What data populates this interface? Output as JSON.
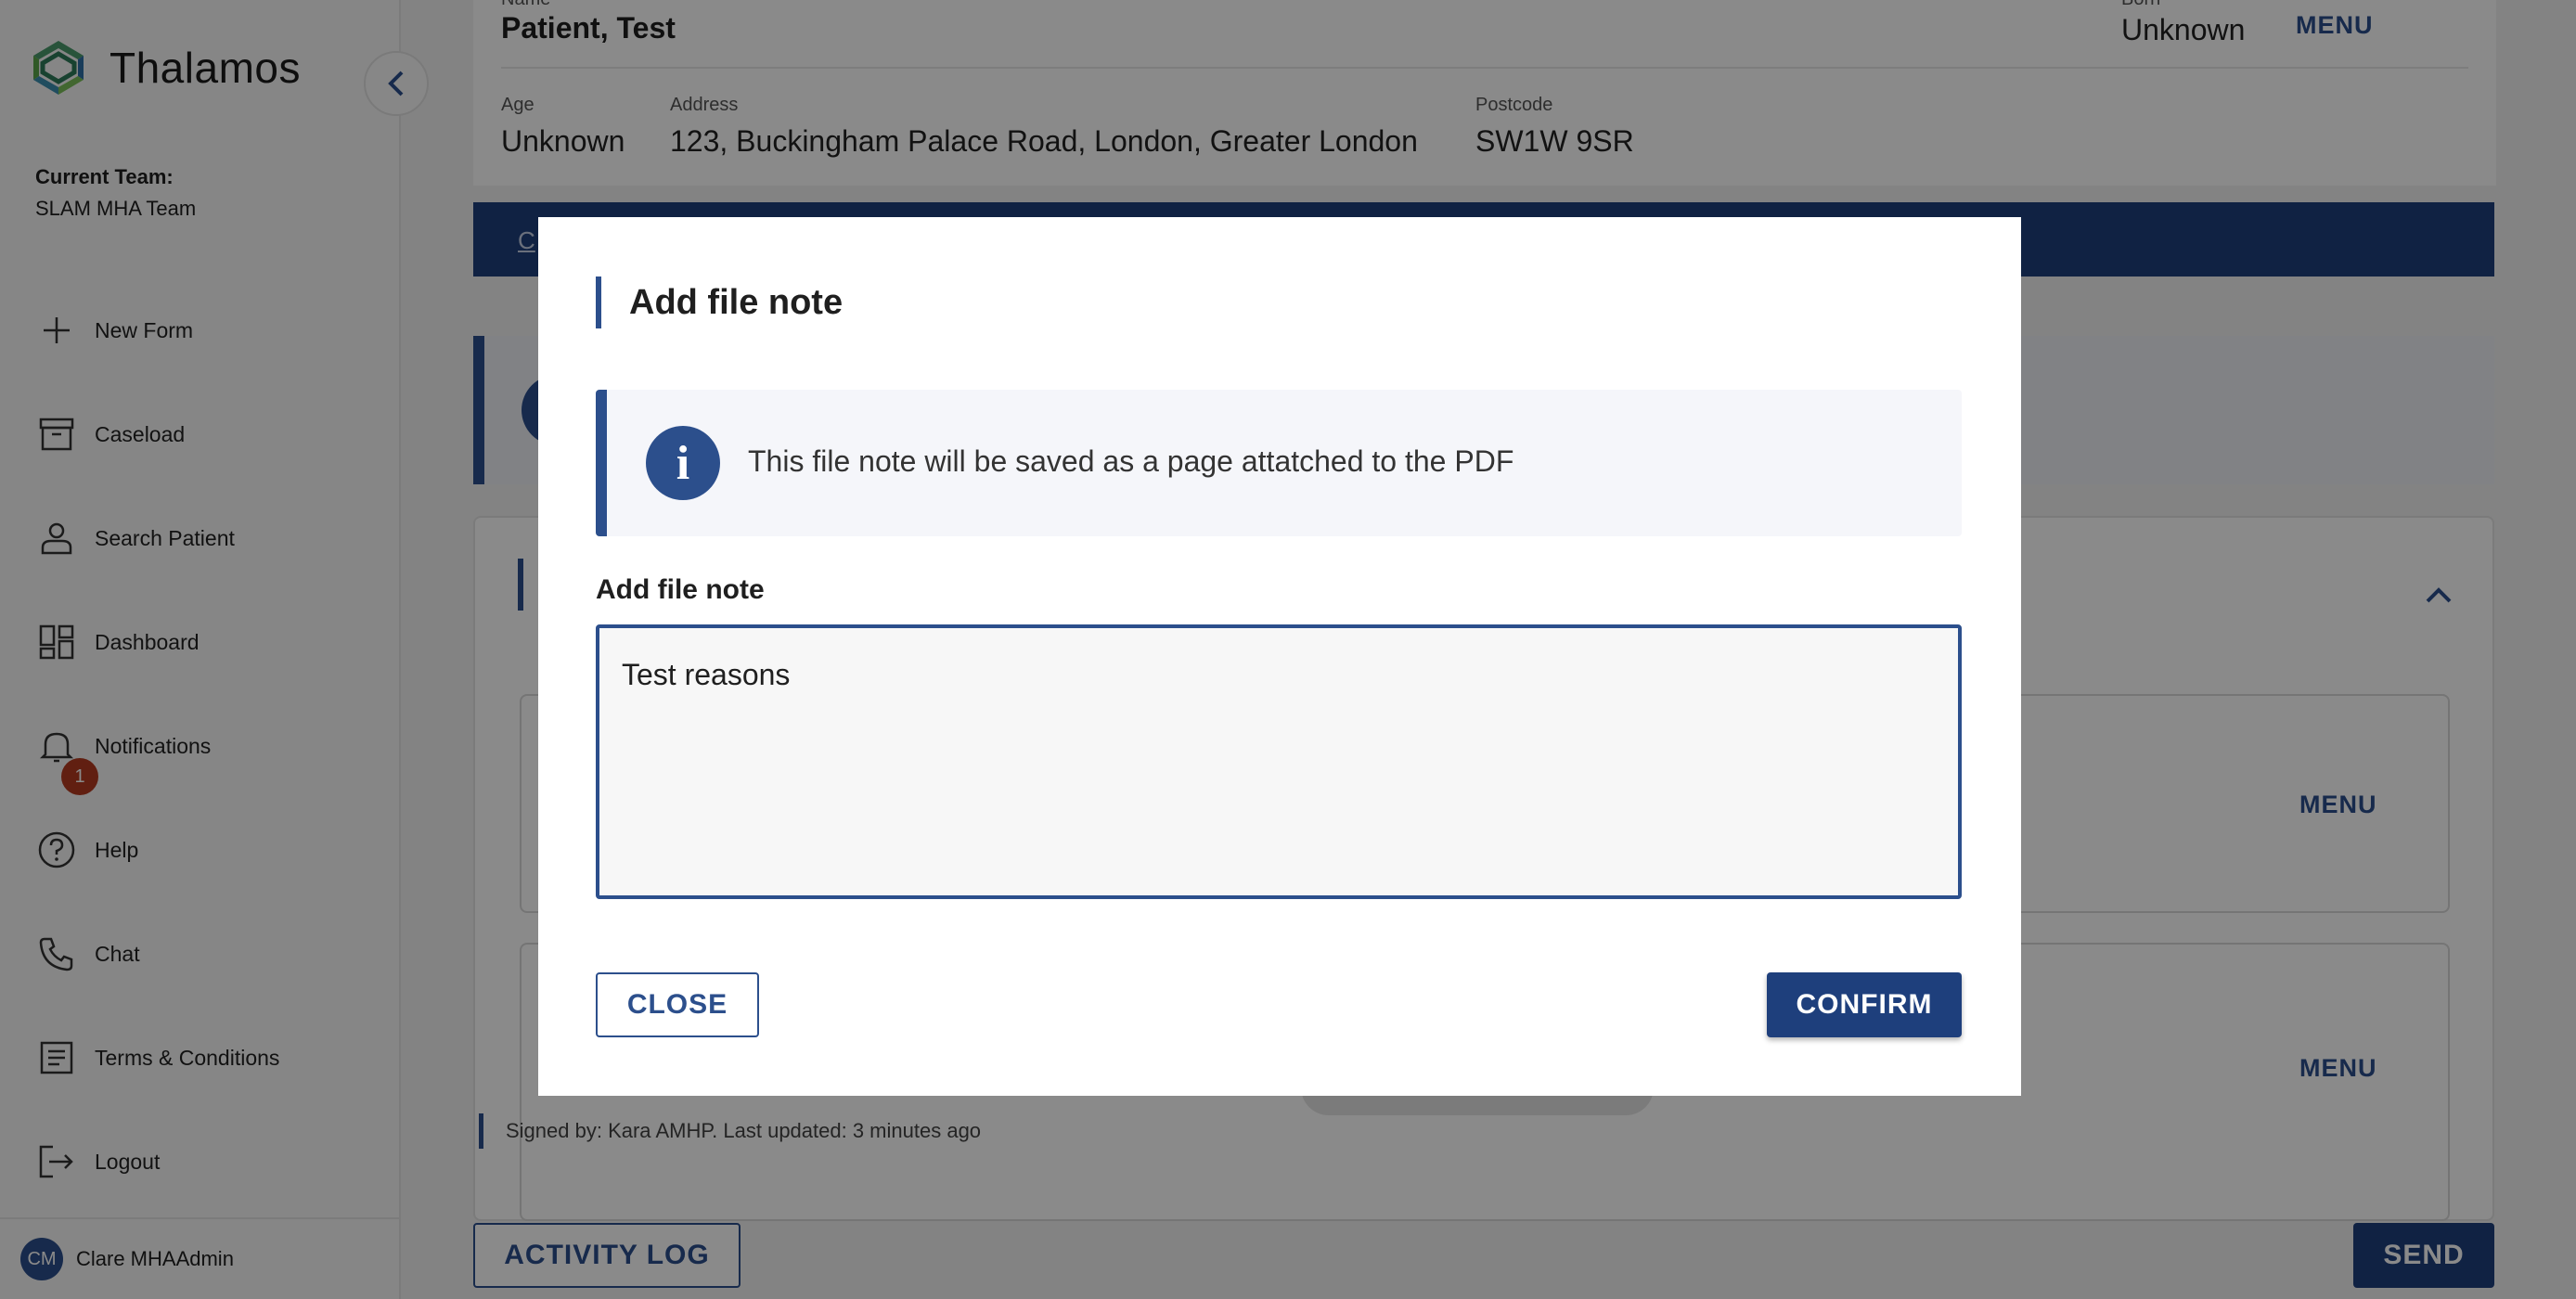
{
  "app": {
    "brand": "Thalamos"
  },
  "sidebar": {
    "team_label": "Current Team:",
    "team_name": "SLAM MHA Team",
    "items": [
      {
        "label": "New Form",
        "icon": "plus-icon"
      },
      {
        "label": "Caseload",
        "icon": "archive-box-icon"
      },
      {
        "label": "Search Patient",
        "icon": "person-icon"
      },
      {
        "label": "Dashboard",
        "icon": "dashboard-grid-icon"
      },
      {
        "label": "Notifications",
        "icon": "bell-icon",
        "badge": "1"
      },
      {
        "label": "Help",
        "icon": "help-circle-icon"
      },
      {
        "label": "Chat",
        "icon": "phone-icon"
      },
      {
        "label": "Terms & Conditions",
        "icon": "document-list-icon"
      },
      {
        "label": "Logout",
        "icon": "logout-icon"
      }
    ],
    "user": {
      "initials": "CM",
      "name": "Clare MHAAdmin"
    }
  },
  "patient": {
    "name_label": "Name",
    "name": "Patient, Test",
    "born_label": "Born",
    "born": "Unknown",
    "menu": "MENU",
    "age_label": "Age",
    "age": "Unknown",
    "address_label": "Address",
    "address": "123, Buckingham Palace Road, London, Greater London",
    "postcode_label": "Postcode",
    "postcode": "SW1W 9SR"
  },
  "tabs": {
    "first_tab_fragment": "C"
  },
  "forms": {
    "menu_1": "MENU",
    "menu_2": "MENU",
    "signed_by": "Signed by: Kara AMHP. Last updated: 3 minutes ago"
  },
  "footer": {
    "activity_log": "ACTIVITY LOG",
    "send": "SEND"
  },
  "modal": {
    "title": "Add file note",
    "info_text": "This file note will be saved as a page attatched to the PDF",
    "field_label": "Add file note",
    "note_value": "Test reasons",
    "close": "CLOSE",
    "confirm": "CONFIRM"
  },
  "colors": {
    "primary": "#1e3f7c",
    "accent": "#2c4f8c",
    "badge": "#b33a20"
  }
}
